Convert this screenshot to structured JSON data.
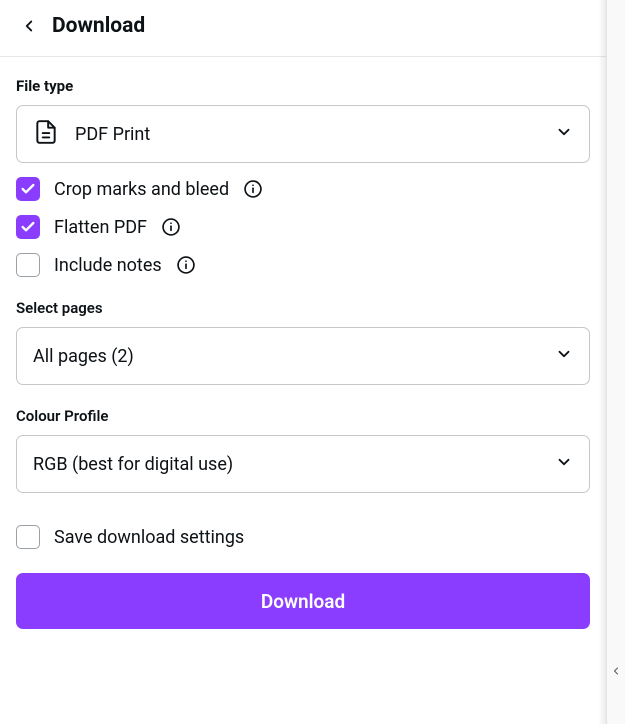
{
  "header": {
    "title": "Download"
  },
  "fileType": {
    "label": "File type",
    "selected": "PDF Print"
  },
  "options": {
    "cropMarks": {
      "label": "Crop marks and bleed",
      "checked": true,
      "hasInfo": true
    },
    "flatten": {
      "label": "Flatten PDF",
      "checked": true,
      "hasInfo": true
    },
    "includeNotes": {
      "label": "Include notes",
      "checked": false,
      "hasInfo": true
    }
  },
  "selectPages": {
    "label": "Select pages",
    "selected": "All pages (2)"
  },
  "colourProfile": {
    "label": "Colour Profile",
    "selected": "RGB (best for digital use)"
  },
  "saveSettings": {
    "label": "Save download settings",
    "checked": false
  },
  "primaryButton": {
    "label": "Download"
  },
  "colors": {
    "accent": "#8b3dff"
  }
}
